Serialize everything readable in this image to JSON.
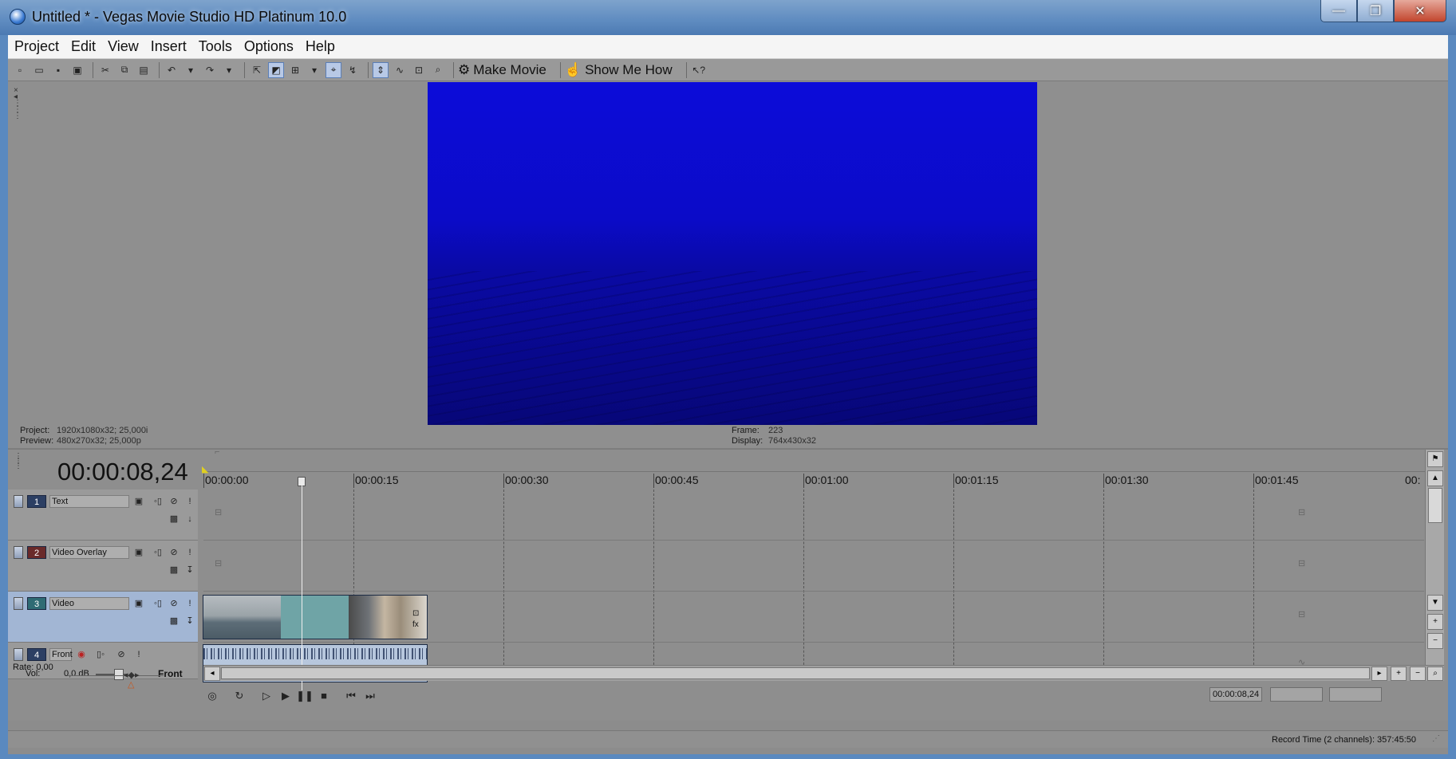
{
  "window": {
    "title": "Untitled * - Vegas Movie Studio HD Platinum 10.0",
    "controls": [
      "—",
      "❐",
      "✕"
    ]
  },
  "menu": [
    "Project",
    "Edit",
    "View",
    "Insert",
    "Tools",
    "Options",
    "Help"
  ],
  "toolbar": {
    "make_movie": "Make Movie",
    "show_me_how": "Show Me How"
  },
  "preview": {
    "project_label": "Project:",
    "project_value": "1920x1080x32; 25,000i",
    "preview_label": "Preview:",
    "preview_value": "480x270x32; 25,000p",
    "frame_label": "Frame:",
    "frame_value": "223",
    "display_label": "Display:",
    "display_value": "764x430x32"
  },
  "timeline": {
    "time_display": "00:00:08,24",
    "ruler": [
      "00:00:00",
      "00:00:15",
      "00:00:30",
      "00:00:45",
      "00:01:00",
      "00:01:15",
      "00:01:30",
      "00:01:45",
      "00:"
    ],
    "tracks": [
      {
        "number": "1",
        "name": "Text"
      },
      {
        "number": "2",
        "name": "Video Overlay"
      },
      {
        "number": "3",
        "name": "Video"
      },
      {
        "number": "4",
        "name": "Front"
      }
    ],
    "audio": {
      "vol_label": "Vol:",
      "vol_value": "0,0 dB",
      "pan_label": "Front"
    },
    "rate": "Rate: 0,00",
    "transport_time": "00:00:08,24"
  },
  "status": {
    "record_time": "Record Time (2 channels): 357:45:50"
  }
}
